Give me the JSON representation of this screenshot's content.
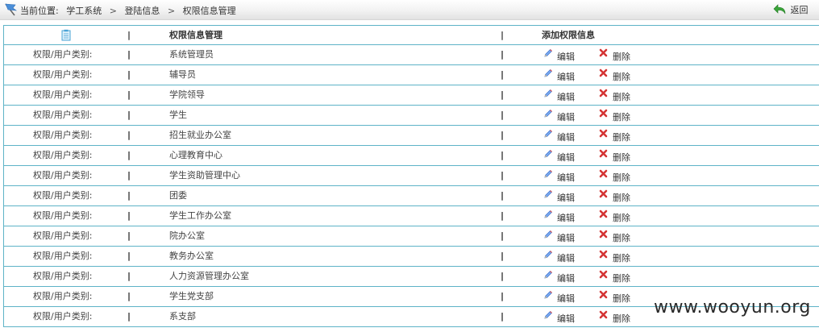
{
  "breadcrumb": {
    "prefix": "当前位置:",
    "items": [
      "学工系统",
      "登陆信息",
      "权限信息管理"
    ],
    "separator": ">"
  },
  "back": {
    "label": "返回"
  },
  "table": {
    "headers": {
      "col2": "权限信息管理",
      "col3": "添加权限信息"
    },
    "separator": "|",
    "row_label": "权限/用户类别:",
    "edit_label": "编辑",
    "delete_label": "删除",
    "rows": [
      "系统管理员",
      "辅导员",
      "学院领导",
      "学生",
      "招生就业办公室",
      "心理教育中心",
      "学生资助管理中心",
      "团委",
      "学生工作办公室",
      "院办公室",
      "教务办公室",
      "人力资源管理办公室",
      "学生党支部",
      "系支部"
    ]
  },
  "colors": {
    "grid_border": "#5eb3c7",
    "edit_icon": "#3b6fd1",
    "delete_icon": "#d43333",
    "back_icon": "#3aa53a"
  },
  "watermark": "www.wooyun.org"
}
